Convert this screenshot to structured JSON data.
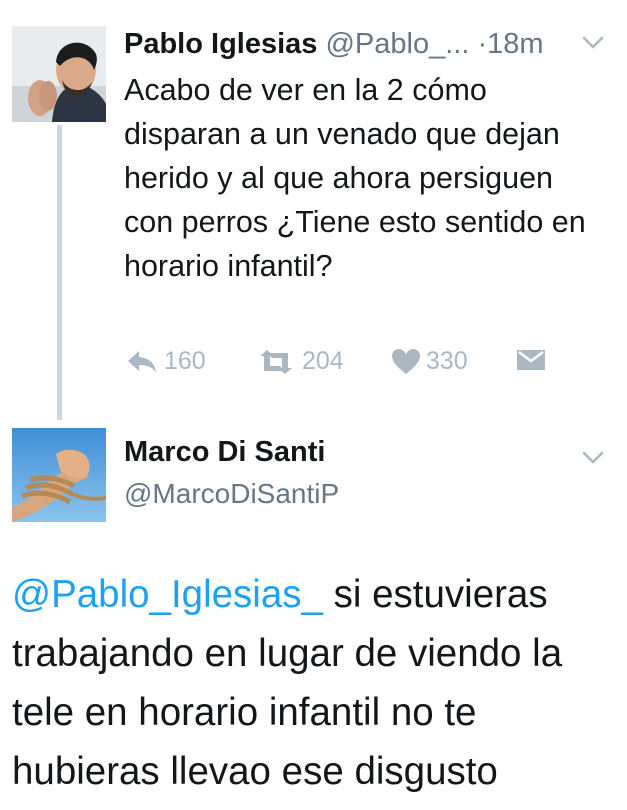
{
  "tweet_parent": {
    "name": "Pablo Iglesias",
    "handle": "@Pablo_...",
    "separator": "·",
    "time": "18m",
    "text": "Acabo de ver en la 2 cómo disparan a un venado que dejan herido y al que ahora persiguen con perros ¿Tiene esto sentido en horario infantil?",
    "actions": {
      "reply_count": "160",
      "retweet_count": "204",
      "like_count": "330"
    },
    "icons": [
      "reply-icon",
      "retweet-icon",
      "heart-icon",
      "direct-message-icon",
      "chevron-down-icon"
    ]
  },
  "tweet_reply": {
    "name": "Marco Di Santi",
    "handle": "@MarcoDiSantiP",
    "mention": "@Pablo_Iglesias_",
    "text": " si estuvieras trabajando en lugar de viendo la tele en horario infantil no te hubieras llevao ese disgusto"
  },
  "colors": {
    "link": "#1da1f2",
    "text": "#14171a",
    "muted": "#657786",
    "icon": "#aab8c2",
    "thread_line": "#ccd6dd"
  }
}
